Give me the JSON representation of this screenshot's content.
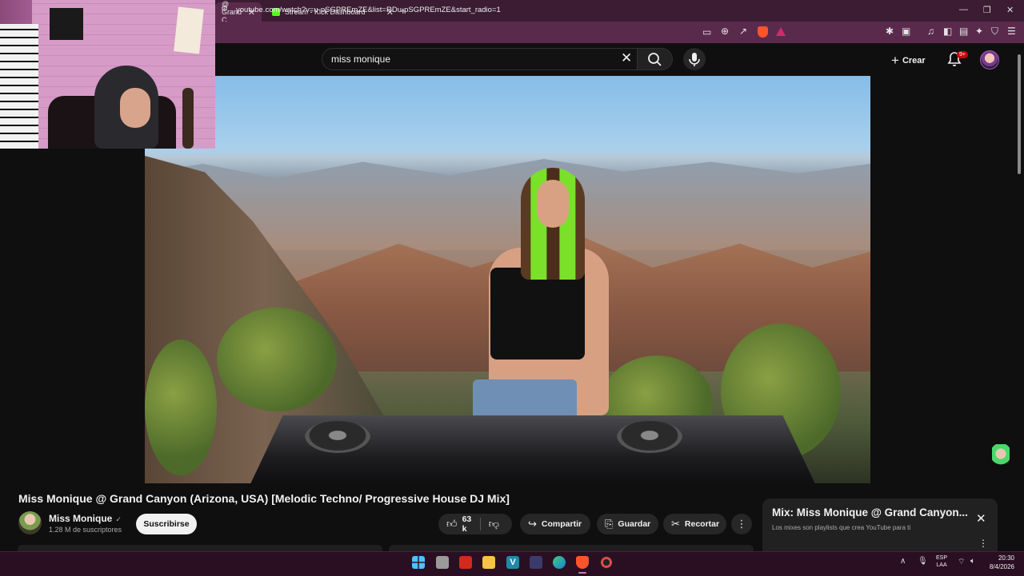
{
  "browser": {
    "tabs": [
      {
        "label": "@ Grand C",
        "close": "✕",
        "active": true
      },
      {
        "label": "Stream - Kick Dashboard",
        "close": "✕",
        "active": false
      }
    ],
    "new_tab": "+",
    "window_controls": {
      "minimize": "—",
      "maximize": "❐",
      "close": "✕"
    },
    "url": "youtube.com/watch?v=u-pSGPREmZE&list=RDu-pSGPREmZE&start_radio=1",
    "colors": {
      "tabbar": "#3b1c33",
      "toolbar": "#5a2a4d",
      "kick_favicon": "#53fc18"
    }
  },
  "youtube": {
    "search": {
      "query": "miss monique"
    },
    "create_label": "Crear",
    "notifications_badge": "9+",
    "video": {
      "title": "Miss Monique @ Grand Canyon (Arizona, USA) [Melodic Techno/ Progressive House DJ Mix]"
    },
    "channel": {
      "name": "Miss Monique",
      "verified_mark": "✓",
      "subscribers": "1.28 M de suscriptores",
      "subscribe_label": "Suscribirse"
    },
    "actions": {
      "likes": "63 k",
      "share": "Compartir",
      "save": "Guardar",
      "clip": "Recortar",
      "more": "⋮"
    },
    "mix": {
      "title": "Mix: Miss Monique @ Grand Canyon...",
      "subtitle": "Los mixes son playlists que crea YouTube para ti",
      "close": "✕",
      "more": "⋮"
    },
    "accent": "#cc0000"
  },
  "taskbar": {
    "language": {
      "line1": "ESP",
      "line2": "LAA"
    },
    "time": "20:30",
    "date": "8/4/2026",
    "tray_caret": "∧"
  }
}
